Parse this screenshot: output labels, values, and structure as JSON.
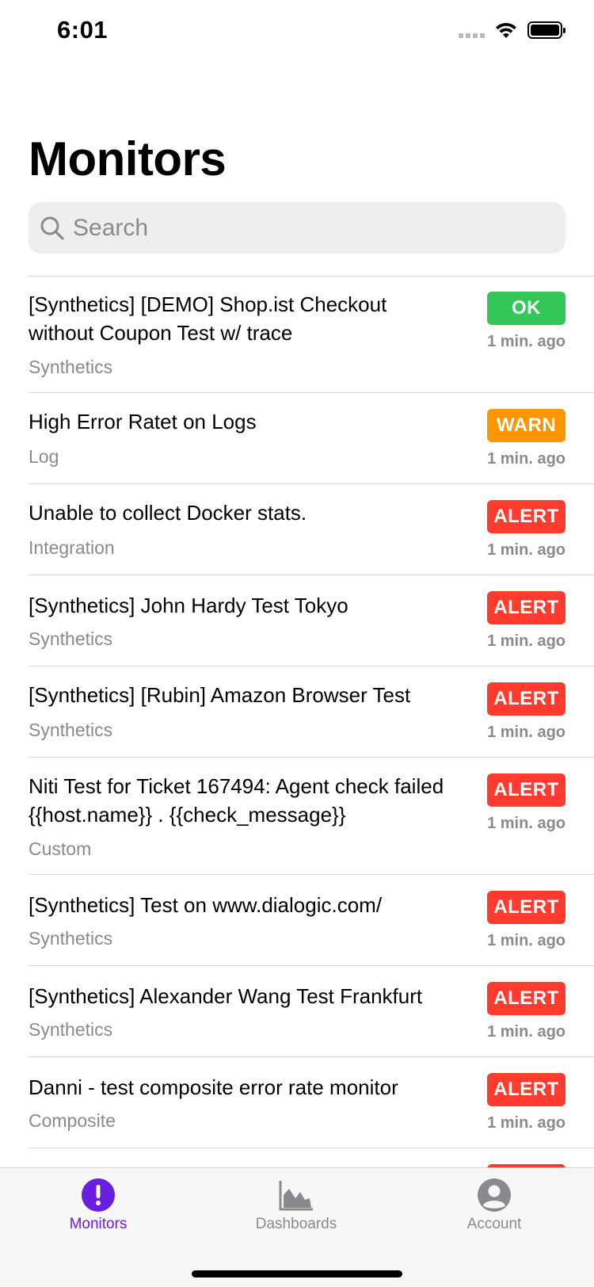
{
  "status_bar": {
    "time": "6:01"
  },
  "header": {
    "title": "Monitors"
  },
  "search": {
    "placeholder": "Search"
  },
  "monitors": [
    {
      "title": "[Synthetics] [DEMO] Shop.ist Checkout without Coupon Test w/ trace",
      "category": "Synthetics",
      "status": "OK",
      "status_color": "#33c759",
      "time": "1 min. ago"
    },
    {
      "title": "High Error Ratet on Logs",
      "category": "Log",
      "status": "WARN",
      "status_color": "#ff9500",
      "time": "1 min. ago"
    },
    {
      "title": "Unable to collect Docker stats.",
      "category": "Integration",
      "status": "ALERT",
      "status_color": "#ff3b30",
      "time": "1 min. ago"
    },
    {
      "title": "[Synthetics] John Hardy Test Tokyo",
      "category": "Synthetics",
      "status": "ALERT",
      "status_color": "#ff3b30",
      "time": "1 min. ago"
    },
    {
      "title": "[Synthetics] [Rubin] Amazon Browser Test",
      "category": "Synthetics",
      "status": "ALERT",
      "status_color": "#ff3b30",
      "time": "1 min. ago"
    },
    {
      "title": "Niti Test for Ticket 167494: Agent check failed {{host.name}} . {{check_message}}",
      "category": "Custom",
      "status": "ALERT",
      "status_color": "#ff3b30",
      "time": "1 min. ago"
    },
    {
      "title": "[Synthetics] Test on www.dialogic.com/",
      "category": "Synthetics",
      "status": "ALERT",
      "status_color": "#ff3b30",
      "time": "1 min. ago"
    },
    {
      "title": "[Synthetics] Alexander Wang Test Frankfurt",
      "category": "Synthetics",
      "status": "ALERT",
      "status_color": "#ff3b30",
      "time": "1 min. ago"
    },
    {
      "title": "Danni - test composite error rate monitor",
      "category": "Composite",
      "status": "ALERT",
      "status_color": "#ff3b30",
      "time": "1 min. ago"
    }
  ],
  "tabbar": {
    "items": [
      {
        "label": "Monitors",
        "icon": "exclamation-circle-icon",
        "active": true
      },
      {
        "label": "Dashboards",
        "icon": "area-chart-icon",
        "active": false
      },
      {
        "label": "Account",
        "icon": "person-circle-icon",
        "active": false
      }
    ],
    "active_color": "#6a1ee0",
    "inactive_color": "#8a8a8e"
  }
}
